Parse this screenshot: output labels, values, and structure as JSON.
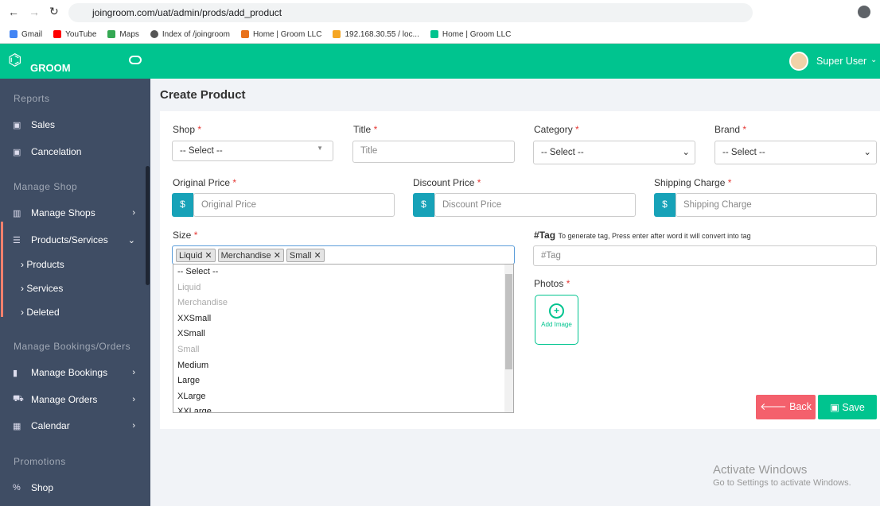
{
  "browser": {
    "url": "joingroom.com/uat/admin/prods/add_product",
    "bookmarks": [
      "Gmail",
      "YouTube",
      "Maps",
      "Index of /joingroom",
      "Home | Groom LLC",
      "192.168.30.55 / loc...",
      "Home | Groom LLC"
    ]
  },
  "header": {
    "logo": "GROOM",
    "user": "Super User"
  },
  "sidebar": {
    "sections": [
      "Reports",
      "Manage Shop",
      "Manage Bookings/Orders",
      "Promotions"
    ],
    "items": [
      {
        "label": "Sales"
      },
      {
        "label": "Cancelation"
      },
      {
        "label": "Manage Shops"
      },
      {
        "label": "Products/Services"
      },
      {
        "label": "Manage Bookings"
      },
      {
        "label": "Manage Orders"
      },
      {
        "label": "Calendar"
      },
      {
        "label": "Shop"
      }
    ],
    "subitems": [
      "Products",
      "Services",
      "Deleted"
    ]
  },
  "page": {
    "title": "Create Product"
  },
  "form": {
    "shop": {
      "label": "Shop",
      "value": "-- Select --"
    },
    "title": {
      "label": "Title",
      "placeholder": "Title"
    },
    "category": {
      "label": "Category",
      "value": "-- Select --"
    },
    "brand": {
      "label": "Brand",
      "value": "-- Select --"
    },
    "original_price": {
      "label": "Original Price",
      "placeholder": "Original Price"
    },
    "discount_price": {
      "label": "Discount Price",
      "placeholder": "Discount Price"
    },
    "shipping": {
      "label": "Shipping Charge",
      "placeholder": "Shipping Charge"
    },
    "currency": "$",
    "size": {
      "label": "Size",
      "selected": [
        "Liquid",
        "Merchandise",
        "Small"
      ],
      "options": [
        {
          "t": "-- Select --",
          "d": false
        },
        {
          "t": "Liquid",
          "d": true
        },
        {
          "t": "Merchandise",
          "d": true
        },
        {
          "t": "XXSmall",
          "d": false
        },
        {
          "t": "XSmall",
          "d": false
        },
        {
          "t": "Small",
          "d": true
        },
        {
          "t": "Medium",
          "d": false
        },
        {
          "t": "Large",
          "d": false
        },
        {
          "t": "XLarge",
          "d": false
        },
        {
          "t": "XXLarge",
          "d": false
        }
      ]
    },
    "tag": {
      "label": "#Tag",
      "hint": "To generate tag, Press enter after word it will convert into tag",
      "placeholder": "#Tag"
    },
    "photos": {
      "label": "Photos",
      "add": "Add Image"
    },
    "required": "*"
  },
  "actions": {
    "back": "Back",
    "save": "Save"
  },
  "watermark": {
    "line1": "Activate Windows",
    "line2": "Go to Settings to activate Windows."
  },
  "colors": {
    "brand": "#00c48f",
    "sidebar": "#3f4d64",
    "back": "#f4606c",
    "addon": "#17a2b8"
  }
}
